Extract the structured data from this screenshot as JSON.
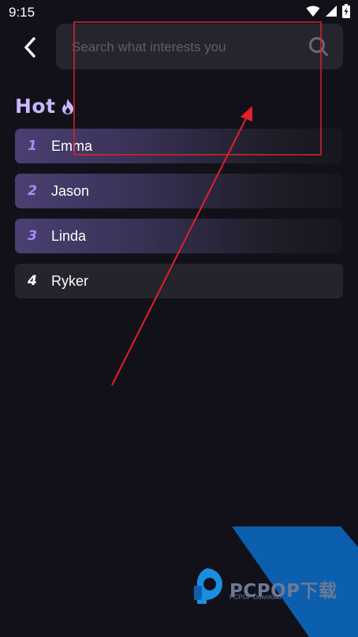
{
  "status_bar": {
    "time": "9:15"
  },
  "header": {
    "back_icon": "chevron-left-icon",
    "search": {
      "placeholder": "Search what interests you",
      "value": "",
      "icon": "search-icon"
    }
  },
  "hot": {
    "title": "Hot",
    "title_icon": "flame-icon",
    "items": [
      {
        "rank": "1",
        "name": "Emma"
      },
      {
        "rank": "2",
        "name": "Jason"
      },
      {
        "rank": "3",
        "name": "Linda"
      },
      {
        "rank": "4",
        "name": "Ryker"
      }
    ]
  },
  "colors": {
    "background": "#12111a",
    "search_bg": "#26252e",
    "accent_purple": "#a98bf5",
    "hot_title": "#c9b8ff",
    "annotation_red": "#e0202a",
    "watermark_blue": "#0b5fae"
  },
  "watermark": {
    "brand": "PCPOP下载",
    "sub": "PCPOP Download"
  }
}
